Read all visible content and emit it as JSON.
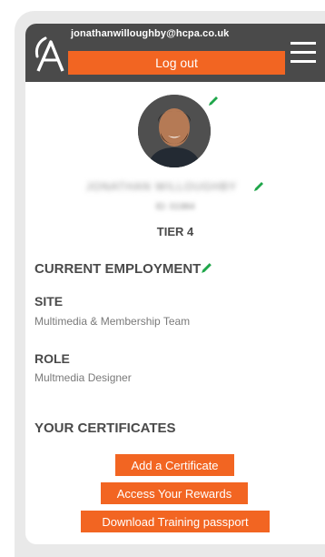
{
  "header": {
    "email": "jonathanwilloughby@hcpa.co.uk",
    "logout_label": "Log out",
    "logo_icon": "ca-logo-icon",
    "menu_icon": "hamburger-menu-icon"
  },
  "profile": {
    "name": "JONATHAN WILLOUGHBY",
    "id": "ID: 01984",
    "tier": "TIER 4"
  },
  "employment": {
    "title": "CURRENT EMPLOYMENT",
    "site_label": "SITE",
    "site_value": "Multimedia & Membership Team",
    "role_label": "ROLE",
    "role_value": "Multmedia Designer"
  },
  "certificates": {
    "title": "YOUR CERTIFICATES",
    "add_label": "Add a Certificate",
    "rewards_label": "Access Your Rewards",
    "passport_label": "Download Training passport"
  },
  "colors": {
    "header_bg": "#4a4a4a",
    "accent": "#f26522",
    "edit_icon": "#1fa64a"
  }
}
